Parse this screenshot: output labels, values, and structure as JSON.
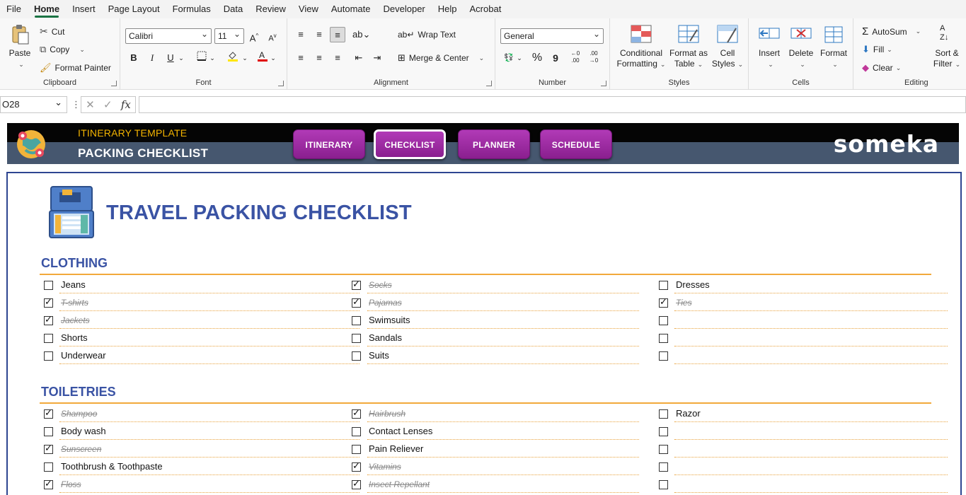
{
  "menu": {
    "tabs": [
      "File",
      "Home",
      "Insert",
      "Page Layout",
      "Formulas",
      "Data",
      "Review",
      "View",
      "Automate",
      "Developer",
      "Help",
      "Acrobat"
    ],
    "active": "Home"
  },
  "ribbon": {
    "clipboard": {
      "paste": "Paste",
      "cut": "Cut",
      "copy": "Copy",
      "format_painter": "Format Painter",
      "label": "Clipboard"
    },
    "font": {
      "name": "Calibri",
      "size": "11",
      "bold": "B",
      "italic": "I",
      "underline": "U",
      "grow": "A",
      "shrink": "A",
      "label": "Font"
    },
    "alignment": {
      "wrap_text": "Wrap Text",
      "merge_center": "Merge & Center",
      "label": "Alignment"
    },
    "number": {
      "format": "General",
      "percent": "%",
      "comma": "9",
      "label": "Number"
    },
    "styles": {
      "conditional": [
        "Conditional",
        "Formatting"
      ],
      "format_table": [
        "Format as",
        "Table"
      ],
      "cell_styles": [
        "Cell",
        "Styles"
      ],
      "label": "Styles"
    },
    "cells": {
      "insert": "Insert",
      "delete": "Delete",
      "format": "Format",
      "label": "Cells"
    },
    "editing": {
      "autosum": "AutoSum",
      "fill": "Fill",
      "clear": "Clear",
      "sort_filter": [
        "Sort &",
        "Filter"
      ],
      "label": "Editing"
    }
  },
  "formula_bar": {
    "name_box": "O28",
    "fx": "fx",
    "formula": ""
  },
  "banner": {
    "subtitle": "ITINERARY TEMPLATE",
    "title": "PACKING CHECKLIST",
    "nav": [
      "ITINERARY",
      "CHECKLIST",
      "PLANNER",
      "SCHEDULE"
    ],
    "active_nav": "CHECKLIST",
    "brand": "someka"
  },
  "page": {
    "title": "TRAVEL PACKING CHECKLIST",
    "sections": [
      {
        "title": "CLOTHING",
        "columns": [
          [
            {
              "label": "Jeans",
              "checked": false
            },
            {
              "label": "T-shirts",
              "checked": true
            },
            {
              "label": "Jackets",
              "checked": true
            },
            {
              "label": "Shorts",
              "checked": false
            },
            {
              "label": "Underwear",
              "checked": false
            }
          ],
          [
            {
              "label": "Socks",
              "checked": true
            },
            {
              "label": "Pajamas",
              "checked": true
            },
            {
              "label": "Swimsuits",
              "checked": false
            },
            {
              "label": "Sandals",
              "checked": false
            },
            {
              "label": "Suits",
              "checked": false
            }
          ],
          [
            {
              "label": "Dresses",
              "checked": false
            },
            {
              "label": "Ties",
              "checked": true
            },
            {
              "label": "",
              "checked": false
            },
            {
              "label": "",
              "checked": false
            },
            {
              "label": "",
              "checked": false
            }
          ]
        ]
      },
      {
        "title": "TOILETRIES",
        "columns": [
          [
            {
              "label": "Shampoo",
              "checked": true
            },
            {
              "label": "Body wash",
              "checked": false
            },
            {
              "label": "Sunscreen",
              "checked": true
            },
            {
              "label": "Toothbrush & Toothpaste",
              "checked": false
            },
            {
              "label": "Floss",
              "checked": true
            }
          ],
          [
            {
              "label": "Hairbrush",
              "checked": true
            },
            {
              "label": "Contact Lenses",
              "checked": false
            },
            {
              "label": "Pain Reliever",
              "checked": false
            },
            {
              "label": "Vitamins",
              "checked": true
            },
            {
              "label": "Insect Repellant",
              "checked": true
            }
          ],
          [
            {
              "label": "Razor",
              "checked": false
            },
            {
              "label": "",
              "checked": false
            },
            {
              "label": "",
              "checked": false
            },
            {
              "label": "",
              "checked": false
            },
            {
              "label": "",
              "checked": false
            }
          ]
        ]
      }
    ]
  },
  "colors": {
    "accent": "#1a7343",
    "nav_purple": "#9c2aa1",
    "title_blue": "#3a53a4",
    "rule_orange": "#f2a93b",
    "banner_top": "#050505",
    "banner_bottom": "#46576f"
  }
}
